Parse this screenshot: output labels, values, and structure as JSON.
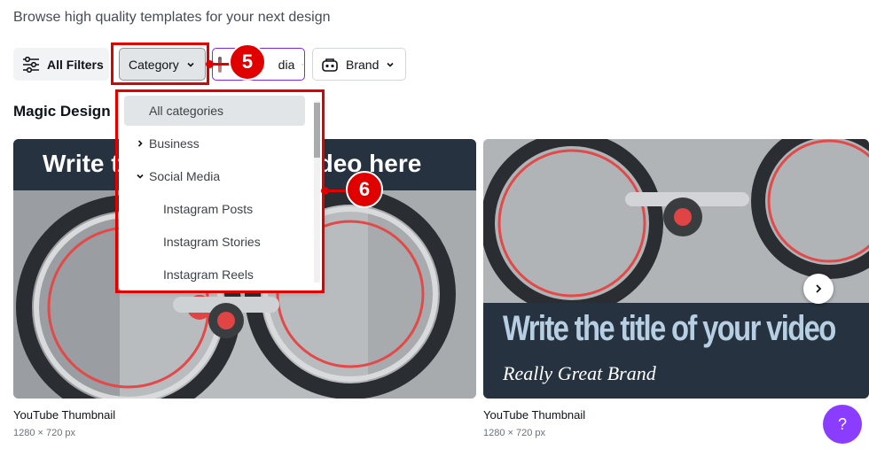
{
  "subtitle": "Browse high quality templates for your next design",
  "filters": {
    "all_filters": "All Filters",
    "category": "Category",
    "media": "Media",
    "brand": "Brand"
  },
  "section_title": "Magic Design",
  "dropdown": {
    "items": [
      {
        "label": "All categories",
        "selected": true,
        "arrow": ""
      },
      {
        "label": "Business",
        "selected": false,
        "arrow": "chevron-right"
      },
      {
        "label": "Social Media",
        "selected": false,
        "arrow": "chevron-down"
      },
      {
        "label": "Instagram Posts",
        "selected": false,
        "arrow": ""
      },
      {
        "label": "Instagram Stories",
        "selected": false,
        "arrow": ""
      },
      {
        "label": "Instagram Reels",
        "selected": false,
        "arrow": ""
      }
    ]
  },
  "annotations": {
    "badge_5": "5",
    "badge_6": "6",
    "color": "#e10000"
  },
  "cards": [
    {
      "title": "YouTube Thumbnail",
      "size": "1280 × 720 px",
      "banner_text": "Write the title of your video here"
    },
    {
      "title": "YouTube Thumbnail",
      "size": "1280 × 720 px",
      "banner_text": "Write the title of your video",
      "brand_text": "Really Great Brand"
    }
  ],
  "help_label": "?",
  "accent_color": "#8b3dff"
}
